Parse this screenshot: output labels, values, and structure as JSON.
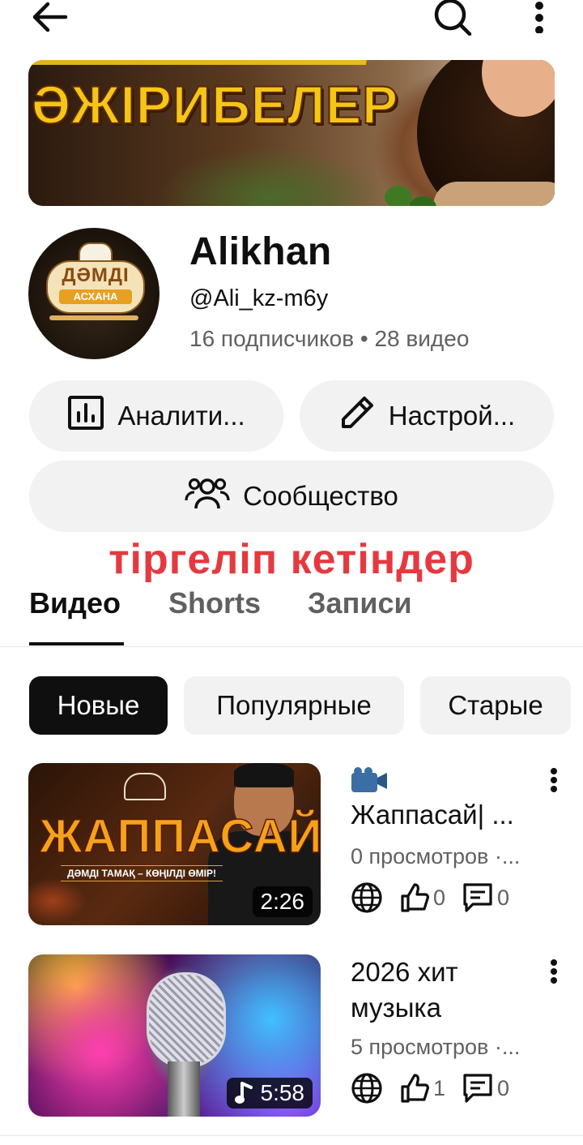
{
  "topbar": {
    "back": "back-arrow-icon",
    "search": "search-icon",
    "more": "more-vert-icon"
  },
  "banner": {
    "text": "ӘЖІРИБЕЛЕР"
  },
  "avatar": {
    "title": "ДӘМДІ",
    "subtitle": "АСХАНА"
  },
  "channel": {
    "name": "Alikhan",
    "handle": "@Ali_kz-m6y",
    "stats": "16 подписчиков • 28 видео"
  },
  "actions": {
    "analytics": "Аналити...",
    "customize": "Настрой...",
    "community": "Сообщество"
  },
  "overlay_caption": "тіргеліп кетіндер",
  "tabs": [
    {
      "label": "Видео",
      "active": true
    },
    {
      "label": "Shorts",
      "active": false
    },
    {
      "label": "Записи",
      "active": false
    }
  ],
  "filters": [
    {
      "label": "Новые",
      "active": true
    },
    {
      "label": "Популярные",
      "active": false
    },
    {
      "label": "Старые",
      "active": false
    }
  ],
  "videos": [
    {
      "thumb_title": "ЖАППАСАЙ",
      "thumb_subtitle": "ДӘМДІ ТАМАҚ – КӨҢІЛДІ ӨМІР!",
      "duration": "2:26",
      "title_emoji": "📹",
      "title": "Жаппасай| ...",
      "views": "0 просмотров ·...",
      "likes": "0",
      "comments": "0"
    },
    {
      "duration": "5:58",
      "duration_icon": "music-note-icon",
      "title": "2026 хит музыка",
      "views": "5 просмотров ·...",
      "likes": "1",
      "comments": "0"
    }
  ],
  "colors": {
    "accent_red": "#e53940",
    "chip_bg": "#f2f2f2",
    "text_secondary": "#606060"
  }
}
